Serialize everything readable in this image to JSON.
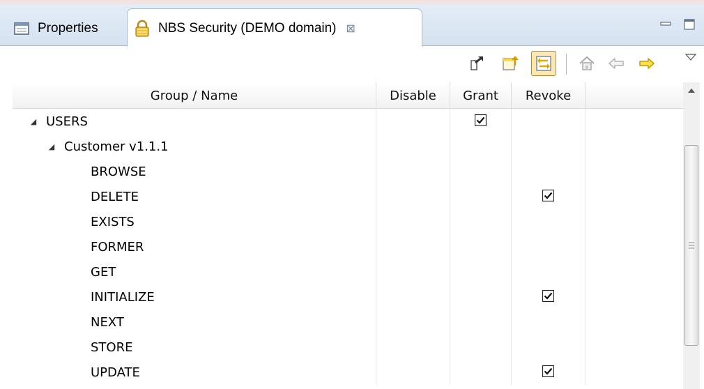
{
  "tabs": [
    {
      "label": "Properties",
      "icon": "properties-icon",
      "active": false
    },
    {
      "label": "NBS Security (DEMO domain)",
      "icon": "lock-icon",
      "active": true,
      "close_glyph": "⊠"
    }
  ],
  "window_controls": {
    "minimize": "minimize-icon",
    "maximize": "maximize-icon"
  },
  "toolbar": {
    "buttons": [
      "export-icon",
      "import-icon",
      "sync-icon",
      "home-icon",
      "back-arrow-icon",
      "forward-arrow-icon"
    ],
    "pressed": "sync-icon",
    "view_menu": "view-menu-icon"
  },
  "table": {
    "columns": [
      "Group / Name",
      "Disable",
      "Grant",
      "Revoke"
    ],
    "rows": [
      {
        "name": "USERS",
        "level": 0,
        "expanded": true,
        "disable": false,
        "grant": true,
        "revoke": false
      },
      {
        "name": "Customer v1.1.1",
        "level": 1,
        "expanded": true,
        "disable": false,
        "grant": false,
        "revoke": false
      },
      {
        "name": "BROWSE",
        "level": 2,
        "disable": false,
        "grant": false,
        "revoke": false
      },
      {
        "name": "DELETE",
        "level": 2,
        "disable": false,
        "grant": false,
        "revoke": true
      },
      {
        "name": "EXISTS",
        "level": 2,
        "disable": false,
        "grant": false,
        "revoke": false
      },
      {
        "name": "FORMER",
        "level": 2,
        "disable": false,
        "grant": false,
        "revoke": false
      },
      {
        "name": "GET",
        "level": 2,
        "disable": false,
        "grant": false,
        "revoke": false
      },
      {
        "name": "INITIALIZE",
        "level": 2,
        "disable": false,
        "grant": false,
        "revoke": true
      },
      {
        "name": "NEXT",
        "level": 2,
        "disable": false,
        "grant": false,
        "revoke": false
      },
      {
        "name": "STORE",
        "level": 2,
        "disable": false,
        "grant": false,
        "revoke": false
      },
      {
        "name": "UPDATE",
        "level": 2,
        "disable": false,
        "grant": false,
        "revoke": true
      }
    ]
  },
  "colors": {
    "tab_bar": "#dce6f4",
    "pressed_button": "#fde8b4",
    "arrow_icon": "#f5c400"
  }
}
